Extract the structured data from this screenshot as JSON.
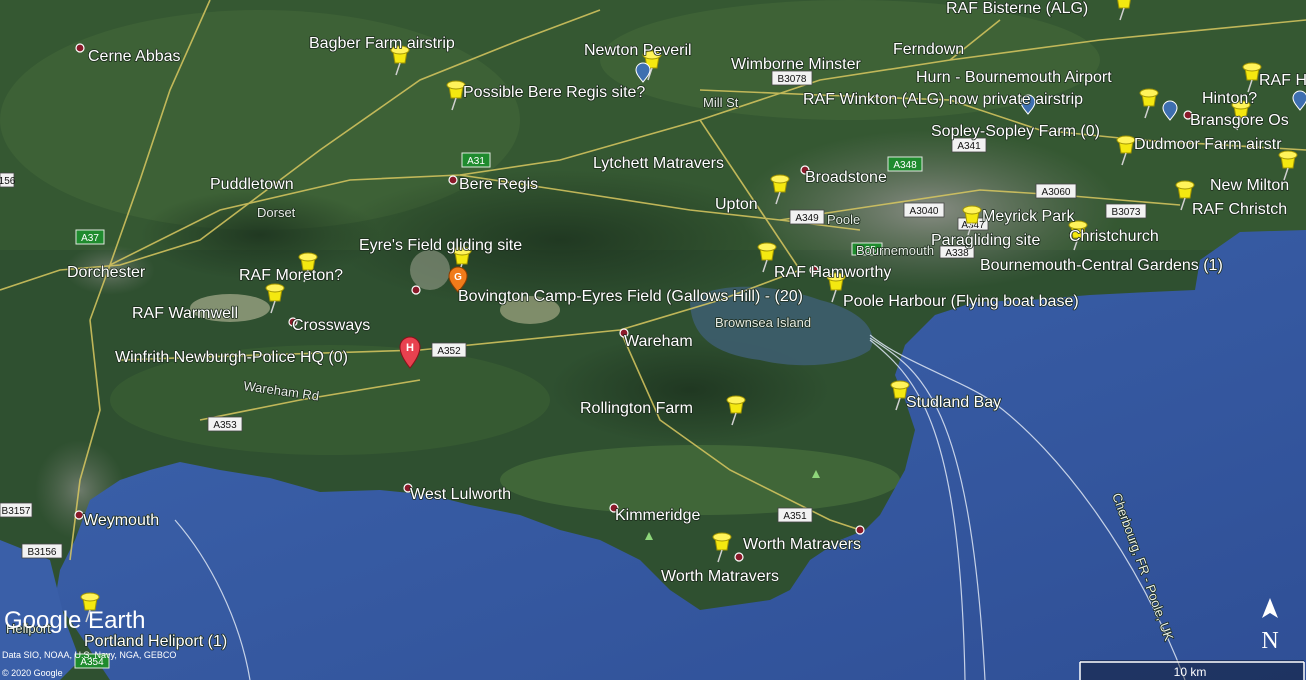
{
  "map": {
    "watermark": "Google Earth",
    "attribution": "Data SIO, NOAA, U.S. Navy, NGA, GEBCO",
    "copyright": "© 2020 Google",
    "scale_label": "10 km",
    "north_label": "N",
    "colors": {
      "sea": "#3a5fa8",
      "land": "#2f5030",
      "pin": "#f2e600",
      "road": "#e8d66a"
    },
    "place_labels": {
      "cerne_abbas": "Cerne Abbas",
      "bagber_farm": "Bagber Farm airstrip",
      "newton_peveril": "Newton Peveril",
      "wimborne_minster": "Wimborne Minster",
      "ferndown": "Ferndown",
      "raf_bisterne": "RAF Bisterne (ALG)",
      "hurn_airport": "Hurn - Bournemouth Airport",
      "raf_h": "RAF H",
      "hinton": "Hinton?",
      "bransgore": "Bransgore Os",
      "possible_bere_regis": "Possible Bere Regis site?",
      "mill_st": "Mill St",
      "raf_winkton": "RAF Winkton (ALG) now private airstrip",
      "sopley_farm": "Sopley-Sopley Farm (0)",
      "dudmoor_farm": "Dudmoor Farm airstr",
      "lytchett_matravers": "Lytchett Matravers",
      "broadstone": "Broadstone",
      "new_milton": "New Milton",
      "puddletown": "Puddletown",
      "bere_regis": "Bere Regis",
      "upton": "Upton",
      "poole": "Poole",
      "meyrick_park": "Meyrick Park",
      "raf_christchurch": "RAF Christch",
      "dorset": "Dorset",
      "eyres_field": "Eyre's Field gliding site",
      "paragliding_site": "Paragliding site",
      "christchurch": "Christchurch",
      "bournemouth": "Bournemouth",
      "dorchester": "Dorchester",
      "raf_moreton": "RAF Moreton?",
      "raf_hamworthy": "RAF Hamworthy",
      "bournemouth_gardens": "Bournemouth-Central Gardens (1)",
      "bovington": "Bovington Camp-Eyres Field (Gallows Hill) - (20)",
      "raf_warmwell": "RAF Warmwell",
      "crossways": "Crossways",
      "poole_harbour": "Poole Harbour (Flying boat base)",
      "brownsea": "Brownsea Island",
      "winfrith": "Winfrith Newburgh-Police HQ (0)",
      "wareham": "Wareham",
      "wareham_rd": "Wareham Rd",
      "studland_bay": "Studland Bay",
      "rollington_farm": "Rollington Farm",
      "west_lulworth": "West Lulworth",
      "weymouth": "Weymouth",
      "kimmeridge": "Kimmeridge",
      "worth_matravers_1": "Worth Matravers",
      "worth_matravers_2": "Worth Matravers",
      "heliport": "Heliport",
      "portland_heliport": "Portland Heliport (1)",
      "ferry_route": "Cherbourg, FR - Poole, UK"
    },
    "roads": {
      "a37": "A37",
      "a31": "A31",
      "a348": "A348",
      "a35_b": "A35",
      "a352": "A352",
      "a353": "A353",
      "a351": "A351",
      "a354": "A354",
      "b3078": "B3078",
      "a341": "A341",
      "a3060": "A3060",
      "a3040": "A3040",
      "a349": "A349",
      "b3073": "B3073",
      "a338": "A338",
      "a347": "A347",
      "b3157": "B3157",
      "b3156": "B3156",
      "r156": "156"
    }
  }
}
